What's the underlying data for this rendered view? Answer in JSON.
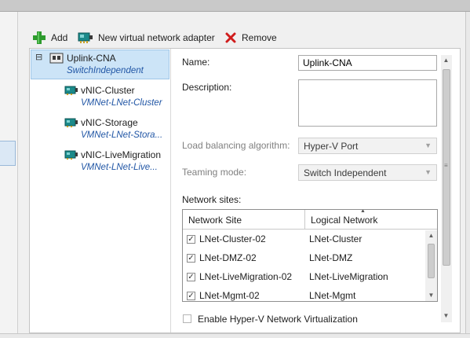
{
  "toolbar": {
    "add_label": "Add",
    "new_adapter_label": "New virtual network adapter",
    "remove_label": "Remove"
  },
  "tree": {
    "root": {
      "name": "Uplink-CNA",
      "sub": "SwitchIndependent",
      "expander": "⊟"
    },
    "children": [
      {
        "name": "vNIC-Cluster",
        "sub": "VMNet-LNet-Cluster"
      },
      {
        "name": "vNIC-Storage",
        "sub": "VMNet-LNet-Stora..."
      },
      {
        "name": "vNIC-LiveMigration",
        "sub": "VMNet-LNet-Live..."
      }
    ]
  },
  "form": {
    "name_label": "Name:",
    "name_value": "Uplink-CNA",
    "description_label": "Description:",
    "description_value": "",
    "lb_label": "Load balancing algorithm:",
    "lb_value": "Hyper-V Port",
    "teaming_label": "Teaming mode:",
    "teaming_value": "Switch Independent",
    "sites_label": "Network sites:",
    "hnv_label": "Enable Hyper-V Network Virtualization"
  },
  "grid": {
    "headers": [
      "Network Site",
      "Logical Network"
    ],
    "rows": [
      {
        "site": "LNet-Cluster-02",
        "logical": "LNet-Cluster",
        "checked": true
      },
      {
        "site": "LNet-DMZ-02",
        "logical": "LNet-DMZ",
        "checked": true
      },
      {
        "site": "LNet-LiveMigration-02",
        "logical": "LNet-LiveMigration",
        "checked": true
      },
      {
        "site": "LNet-Mgmt-02",
        "logical": "LNet-Mgmt",
        "checked": true
      }
    ],
    "sort_indicator": "▲"
  },
  "colors": {
    "selection_bg": "#cce4f7",
    "link_blue": "#2156a5",
    "add_green": "#2e9b2e",
    "remove_red": "#d01c1c"
  },
  "icons": {
    "add": "plus-icon",
    "new_adapter": "network-adapter-icon",
    "remove": "x-icon",
    "root_node": "network-card-icon",
    "child_node": "vnic-icon",
    "check": "✓"
  }
}
